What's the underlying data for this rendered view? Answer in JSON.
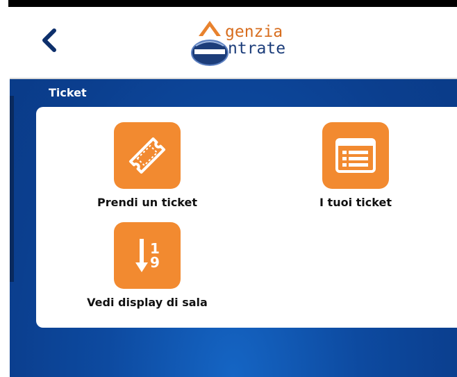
{
  "header": {
    "back_icon": "chevron-left-icon",
    "logo": {
      "line1": "genzia",
      "line2": "ntrate",
      "colors": {
        "orange": "#d76d1e",
        "navy": "#1c3d7a"
      }
    }
  },
  "section": {
    "title": "Ticket"
  },
  "tiles": [
    {
      "label": "Prendi un ticket",
      "icon": "ticket-icon"
    },
    {
      "label": "I tuoi ticket",
      "icon": "ticket-list-icon"
    },
    {
      "label": "Vedi display di sala",
      "icon": "sort-display-icon",
      "digit_top": "1",
      "digit_bottom": "9"
    }
  ],
  "colors": {
    "accent": "#f28a30",
    "background": "#0d4aa0",
    "card": "#ffffff"
  }
}
